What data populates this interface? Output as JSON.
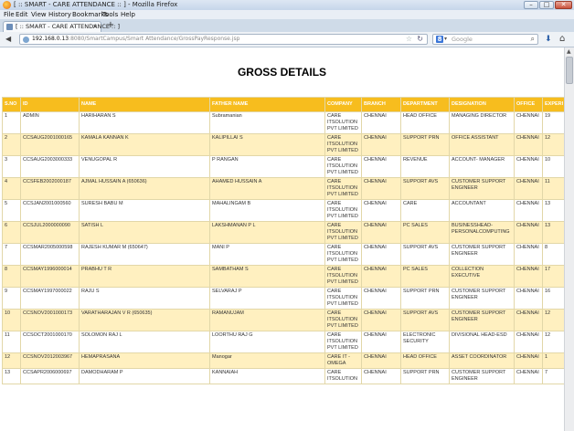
{
  "window": {
    "title": "[ :: SMART - CARE ATTENDANCE :: ] - Mozilla Firefox",
    "minimize": "–",
    "maximize": "□",
    "close": "✕"
  },
  "menu": [
    "File",
    "Edit",
    "View",
    "History",
    "Bookmarks",
    "Tools",
    "Help"
  ],
  "tab": {
    "title": "[ :: SMART - CARE ATTENDANCE :: ]",
    "close": "×",
    "new": "+"
  },
  "nav": {
    "back": "◀",
    "url_host": "192.168.0.13",
    "url_path": ":8080/SmartCampus/Smart Attendance/GrossPayResponse.jsp",
    "bookmark_star": "☆",
    "search_engine": "8",
    "search_placeholder": "Google",
    "download": "⬇",
    "home": "⌂"
  },
  "page": {
    "heading": "GROSS DETAILS"
  },
  "table": {
    "columns": [
      "S.NO",
      "ID",
      "NAME",
      "FATHER NAME",
      "COMPANY",
      "BRANCH",
      "DEPARTMENT",
      "DESIGNATION",
      "OFFICE",
      "EXPERI"
    ],
    "rows": [
      [
        "1",
        "ADMIN",
        "HARIHARAN S",
        "Subramanian",
        "CARE ITSOLUTION PVT LIMITED",
        "CHENNAI",
        "HEAD OFFICE",
        "MANAGING DIRECTOR",
        "CHENNAI",
        "19"
      ],
      [
        "2",
        "CCSAUG2001000165",
        "KAMALA KANNAN K",
        "KALIPILLAI S",
        "CARE ITSOLUTION PVT LIMITED",
        "CHENNAI",
        "SUPPORT PRN",
        "OFFICE ASSISTANT",
        "CHENNAI",
        "12"
      ],
      [
        "3",
        "CCSAUG2003000333",
        "VENUGOPAL R",
        "P RANGAN",
        "CARE ITSOLUTION PVT LIMITED",
        "CHENNAI",
        "REVENUE",
        "ACCOUNT- MANAGER",
        "CHENNAI",
        "10"
      ],
      [
        "4",
        "CCSFEB2002000187",
        "AJMAL HUSSAIN A (650636)",
        "AHAMED HUSSAIN A",
        "CARE ITSOLUTION PVT LIMITED",
        "CHENNAI",
        "SUPPORT AVS",
        "CUSTOMER SUPPORT ENGINEER",
        "CHENNAI",
        "11"
      ],
      [
        "5",
        "CCSJAN2001000560",
        "SURESH BABU M",
        "MAHALINGAM B",
        "CARE ITSOLUTION PVT LIMITED",
        "CHENNAI",
        "CARE",
        "ACCOUNTANT",
        "CHENNAI",
        "13"
      ],
      [
        "6",
        "CCSJUL2000000090",
        "SATISH L",
        "LAKSHMANAN P L",
        "CARE ITSOLUTION PVT LIMITED",
        "CHENNAI",
        "PC SALES",
        "BUSINESSHEAD-PERSONALCOMPUTING",
        "CHENNAI",
        "13"
      ],
      [
        "7",
        "CCSMAR2005000598",
        "RAJESH KUMAR M (650647)",
        "MANI P",
        "CARE ITSOLUTION PVT LIMITED",
        "CHENNAI",
        "SUPPORT AVS",
        "CUSTOMER SUPPORT ENGINEER",
        "CHENNAI",
        "8"
      ],
      [
        "8",
        "CCSMAY1996000014",
        "PRABHU T R",
        "SAMBATHAM S",
        "CARE ITSOLUTION PVT LIMITED",
        "CHENNAI",
        "PC SALES",
        "COLLECTION EXECUTIVE",
        "CHENNAI",
        "17"
      ],
      [
        "9",
        "CCSMAY1997000022",
        "RAJU S",
        "SELVARAJ P",
        "CARE ITSOLUTION PVT LIMITED",
        "CHENNAI",
        "SUPPORT PRN",
        "CUSTOMER SUPPORT ENGINEER",
        "CHENNAI",
        "16"
      ],
      [
        "10",
        "CCSNOV2001000173",
        "VARATHARAJAN V R (650635)",
        "RAMANUJAM",
        "CARE ITSOLUTION PVT LIMITED",
        "CHENNAI",
        "SUPPORT AVS",
        "CUSTOMER SUPPORT ENGINEER",
        "CHENNAI",
        "12"
      ],
      [
        "11",
        "CCSOCT2001000170",
        "SOLOMON RAJ L",
        "LOORTHU RAJ G",
        "CARE ITSOLUTION PVT LIMITED",
        "CHENNAI",
        "ELECTRONIC SECURITY",
        "DIVISIONAL HEAD-ESD",
        "CHENNAI",
        "12"
      ],
      [
        "12",
        "CCSNOV2012003967",
        "HEMAPRASANA",
        "Manogar",
        "CARE IT -OMEGA",
        "CHENNAI",
        "HEAD OFFICE",
        "ASSET COORDINATOR",
        "CHENNAI",
        "1"
      ],
      [
        "13",
        "CCSAPR2006000697",
        "DAMODHARAM P",
        "KANNAIAH",
        "CARE ITSOLUTION",
        "CHENNAI",
        "SUPPORT PRN",
        "CUSTOMER SUPPORT ENGINEER",
        "CHENNAI",
        "7"
      ]
    ]
  }
}
